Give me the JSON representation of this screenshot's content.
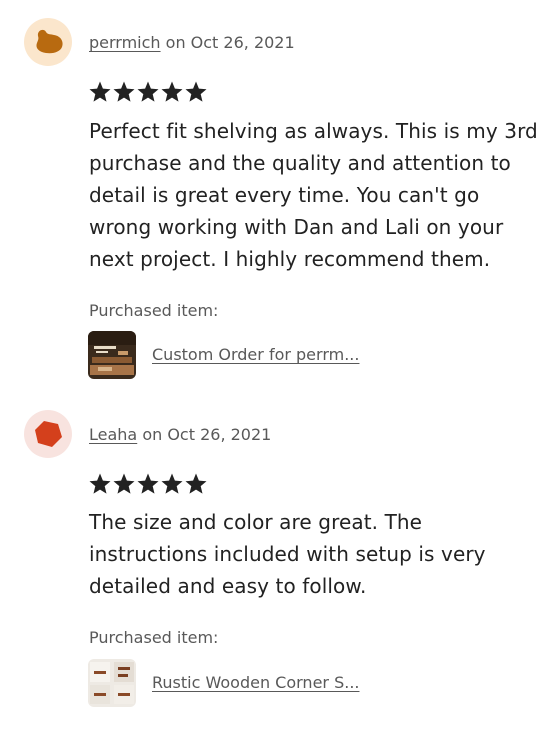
{
  "reviews": [
    {
      "username": "perrmich",
      "date_text": " on Oct 26, 2021",
      "rating": 5,
      "avatar_icon": "blob-avatar-icon",
      "avatar_bg": "#fbe6cc",
      "avatar_fg": "#b86a10",
      "text": "Perfect fit shelving as always. This is my 3rd purchase and the quality and attention to detail is great every time. You can't go wrong working with Dan and Lali on your next project. I highly recommend them.",
      "purchased_label": "Purchased item:",
      "item_title": "Custom Order for perrm...",
      "item_thumb_icon": "custom-order-thumbnail"
    },
    {
      "username": "Leaha",
      "date_text": " on Oct 26, 2021",
      "rating": 5,
      "avatar_icon": "pentagon-avatar-icon",
      "avatar_bg": "#f8e3df",
      "avatar_fg": "#d4401c",
      "text": "The size and color are great. The instructions included with setup is very detailed and easy to follow.",
      "purchased_label": "Purchased item:",
      "item_title": "Rustic Wooden Corner S...",
      "item_thumb_icon": "corner-shelf-thumbnail"
    }
  ]
}
